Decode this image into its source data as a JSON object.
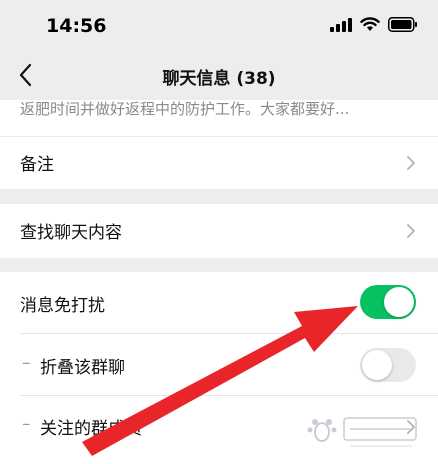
{
  "status_bar": {
    "time": "14:56",
    "icons": [
      "signal-icon",
      "wifi-icon",
      "battery-icon"
    ]
  },
  "nav": {
    "title": "聊天信息 (38)",
    "back_icon": "chevron-left-icon"
  },
  "announcement": {
    "text": "返肥时间并做好返程中的防护工作。大家都要好..."
  },
  "rows": {
    "remark": {
      "label": "备注"
    },
    "search_chat": {
      "label": "查找聊天内容"
    },
    "mute": {
      "label": "消息免打扰",
      "toggle_on": true
    },
    "fold": {
      "label": "折叠该群聊",
      "toggle_on": false
    },
    "followed": {
      "label": "关注的群成员"
    }
  },
  "colors": {
    "accent_green": "#07c160",
    "arrow_red": "#e8262a",
    "background": "#ededed"
  },
  "watermark": {
    "logo": "baidu-jingyan-logo"
  }
}
